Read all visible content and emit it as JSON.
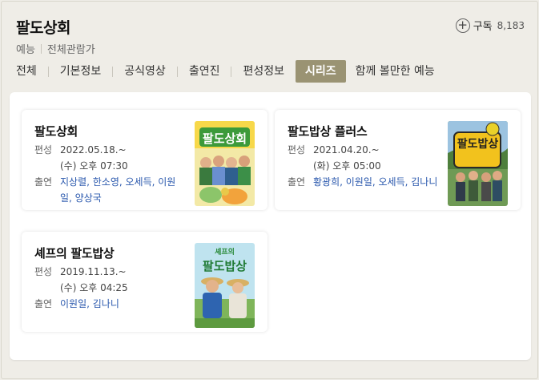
{
  "header": {
    "title": "팔도상회",
    "subscribe_label": "구독",
    "subscribe_count": "8,183",
    "genre": "예능",
    "rating": "전체관람가"
  },
  "tabs": [
    {
      "label": "전체"
    },
    {
      "label": "기본정보"
    },
    {
      "label": "공식영상"
    },
    {
      "label": "출연진"
    },
    {
      "label": "편성정보"
    },
    {
      "label": "시리즈",
      "active": true
    },
    {
      "label": "함께 볼만한 예능"
    }
  ],
  "labels": {
    "schedule": "편성",
    "cast": "출연"
  },
  "series": [
    {
      "title": "팔도상회",
      "date": "2022.05.18.~",
      "time": "(수) 오후 07:30",
      "cast": "지상렬, 한소영, 오세득, 이원일, 양상국",
      "poster_text": "팔도상회"
    },
    {
      "title": "팔도밥상 플러스",
      "date": "2021.04.20.~",
      "time": "(화) 오후 05:00",
      "cast": "황광희, 이원일, 오세득, 김나니",
      "poster_text": "팔도밥상"
    },
    {
      "title": "셰프의 팔도밥상",
      "date": "2019.11.13.~",
      "time": "(수) 오후 04:25",
      "cast": "이원일, 김나니",
      "poster_text": "팔도밥상",
      "poster_subtext": "셰프의"
    }
  ],
  "colors": {
    "accent_tab": "#9a9373",
    "cast_link": "#2a58ad",
    "background": "#efede7"
  }
}
